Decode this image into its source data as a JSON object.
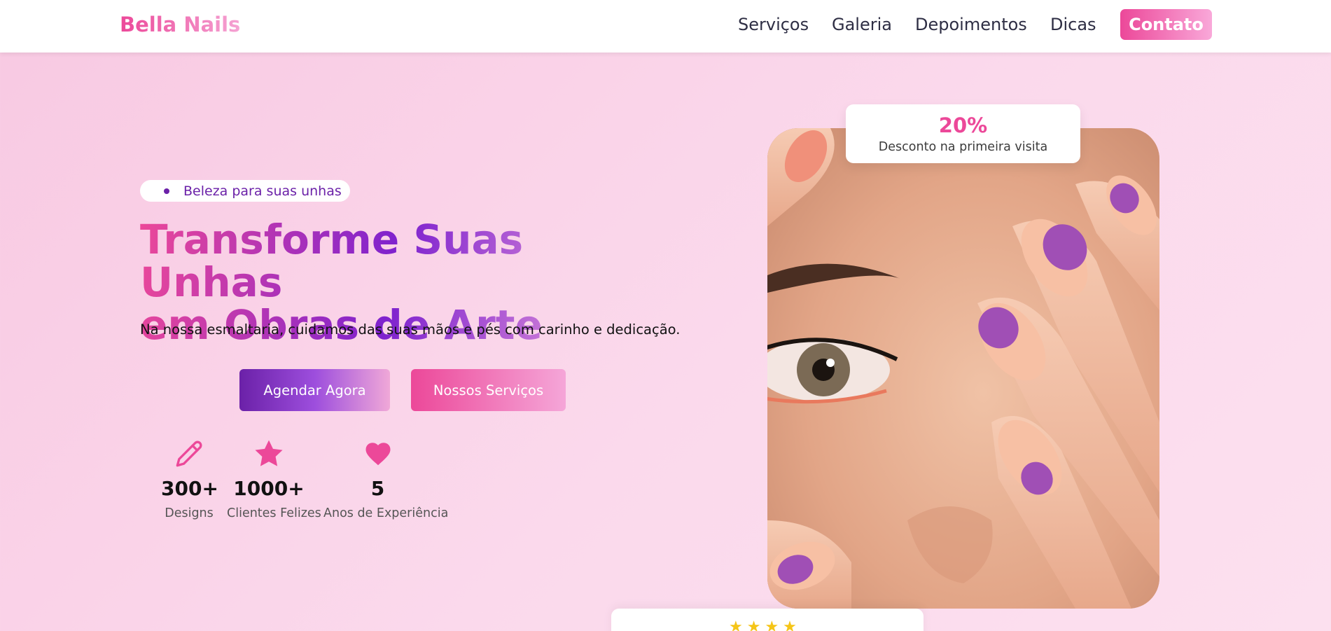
{
  "nav": {
    "brand": "Bella Nails",
    "links": [
      "Serviços",
      "Galeria",
      "Depoimentos",
      "Dicas"
    ],
    "cta": "Contato"
  },
  "hero": {
    "badge": "Beleza para suas unhas",
    "title_line1": "Transforme Suas Unhas",
    "title_line2": "em Obras de Arte",
    "subtitle": "Na nossa esmaltaria, cuidamos das suas mãos e pés com carinho e dedicação.",
    "primary_button": "Agendar Agora",
    "secondary_button": "Nossos Serviços"
  },
  "stats": [
    {
      "value": "300+",
      "label": "Designs",
      "icon": "pencil-icon"
    },
    {
      "value": "1000+",
      "label": "Clientes Felizes",
      "icon": "star-icon"
    },
    {
      "value": "5",
      "label": "Anos de Experiência",
      "icon": "heart-icon"
    }
  ],
  "promo": {
    "value": "20%",
    "label": "Desconto na primeira visita"
  },
  "review": {
    "stars": 4,
    "icon": "star-rating-icon"
  },
  "colors": {
    "pink": "#ec4899",
    "purple": "#6b21a8",
    "light_pink": "#f9a8d9",
    "star_yellow": "#f5c518"
  },
  "hero_image": "close-up-face-with-manicured-nails"
}
